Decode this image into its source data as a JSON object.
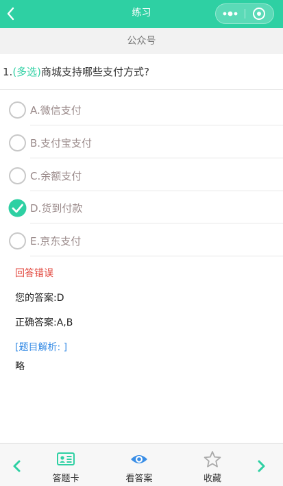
{
  "nav": {
    "title": "练习"
  },
  "header": {
    "subtitle": "公众号"
  },
  "question": {
    "number": "1.",
    "type": "(多选)",
    "text": "商城支持哪些支付方式?"
  },
  "options": [
    {
      "label": "A.微信支付",
      "selected": false
    },
    {
      "label": "B.支付宝支付",
      "selected": false
    },
    {
      "label": "C.余额支付",
      "selected": false
    },
    {
      "label": "D.货到付款",
      "selected": true
    },
    {
      "label": "E.京东支付",
      "selected": false
    }
  ],
  "result": {
    "status": "回答错误",
    "your_answer_label": "您的答案:",
    "your_answer": "D",
    "correct_answer_label": "正确答案:",
    "correct_answer": "A,B",
    "analysis_title": "[题目解析: ]",
    "analysis_text": "略"
  },
  "toolbar": {
    "answer_card": "答题卡",
    "view_answer": "看答案",
    "favorite": "收藏"
  },
  "colors": {
    "accent": "#2ed0a3",
    "error": "#e2463c",
    "link": "#3a8ee6"
  }
}
